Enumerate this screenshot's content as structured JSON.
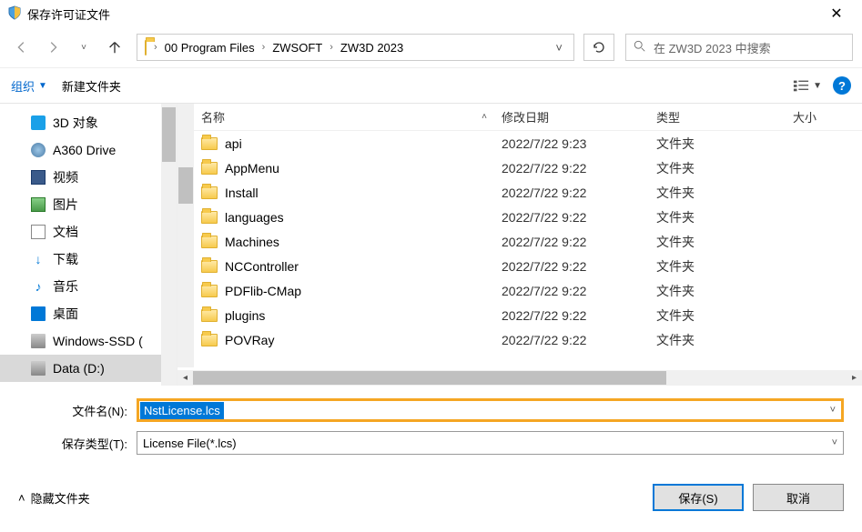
{
  "title": "保存许可证文件",
  "breadcrumb": [
    "00 Program Files",
    "ZWSOFT",
    "ZW3D 2023"
  ],
  "search_placeholder": "在 ZW3D 2023 中搜索",
  "toolbar": {
    "organize": "组织",
    "new_folder": "新建文件夹"
  },
  "sidebar": {
    "items": [
      {
        "label": "3D 对象",
        "icon": "3d"
      },
      {
        "label": "A360 Drive",
        "icon": "a360"
      },
      {
        "label": "视频",
        "icon": "video"
      },
      {
        "label": "图片",
        "icon": "pic"
      },
      {
        "label": "文档",
        "icon": "doc"
      },
      {
        "label": "下载",
        "icon": "dl"
      },
      {
        "label": "音乐",
        "icon": "music"
      },
      {
        "label": "桌面",
        "icon": "desktop"
      },
      {
        "label": "Windows-SSD (",
        "icon": "disk"
      },
      {
        "label": "Data (D:)",
        "icon": "disk",
        "selected": true
      }
    ]
  },
  "columns": {
    "name": "名称",
    "date": "修改日期",
    "type": "类型",
    "size": "大小"
  },
  "files": [
    {
      "name": "api",
      "date": "2022/7/22 9:23",
      "type": "文件夹"
    },
    {
      "name": "AppMenu",
      "date": "2022/7/22 9:22",
      "type": "文件夹"
    },
    {
      "name": "Install",
      "date": "2022/7/22 9:22",
      "type": "文件夹"
    },
    {
      "name": "languages",
      "date": "2022/7/22 9:22",
      "type": "文件夹"
    },
    {
      "name": "Machines",
      "date": "2022/7/22 9:22",
      "type": "文件夹"
    },
    {
      "name": "NCController",
      "date": "2022/7/22 9:22",
      "type": "文件夹"
    },
    {
      "name": "PDFlib-CMap",
      "date": "2022/7/22 9:22",
      "type": "文件夹"
    },
    {
      "name": "plugins",
      "date": "2022/7/22 9:22",
      "type": "文件夹"
    },
    {
      "name": "POVRay",
      "date": "2022/7/22 9:22",
      "type": "文件夹"
    }
  ],
  "filename_label": "文件名(N):",
  "filename_value": "NstLicense.lcs",
  "filetype_label": "保存类型(T):",
  "filetype_value": "License File(*.lcs)",
  "hide_folders": "隐藏文件夹",
  "save_btn": "保存(S)",
  "cancel_btn": "取消"
}
